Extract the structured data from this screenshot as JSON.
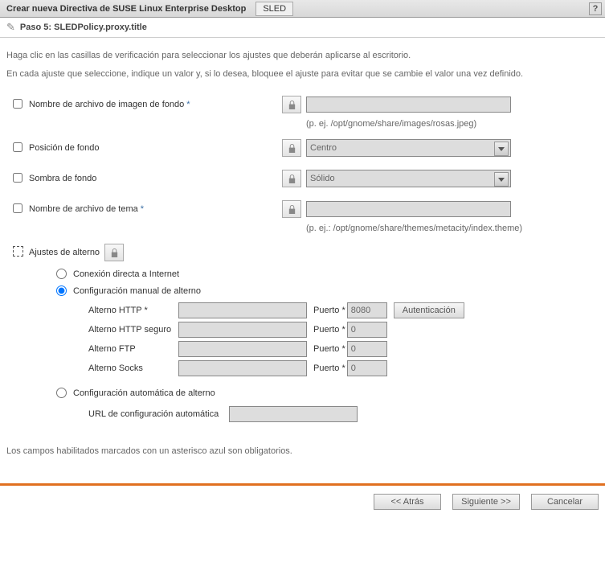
{
  "titlebar": {
    "title": "Crear nueva Directiva de SUSE Linux Enterprise Desktop",
    "tab": "SLED",
    "help": "?"
  },
  "step": {
    "prefix": "Paso 5:",
    "name": "SLEDPolicy.proxy.title"
  },
  "intro": {
    "line1": "Haga clic en las casillas de verificación para seleccionar los ajustes que deberán aplicarse al escritorio.",
    "line2": "En cada ajuste que seleccione, indique un valor y, si lo desea, bloquee el ajuste para evitar que se cambie el valor una vez definido."
  },
  "fields": {
    "bgimage": {
      "label": "Nombre de archivo de imagen de fondo",
      "required": true,
      "hint": "(p. ej. /opt/gnome/share/images/rosas.jpeg)",
      "value": ""
    },
    "bgpos": {
      "label": "Posición de fondo",
      "required": false,
      "value": "Centro"
    },
    "bgshade": {
      "label": "Sombra de fondo",
      "required": false,
      "value": "Sólido"
    },
    "theme": {
      "label": "Nombre de archivo de tema",
      "required": true,
      "hint": "(p. ej.: /opt/gnome/share/themes/metacity/index.theme)",
      "value": ""
    },
    "proxy": {
      "label": "Ajustes de alterno"
    }
  },
  "proxy": {
    "direct": "Conexión directa a Internet",
    "manual": "Configuración manual de alterno",
    "auto": "Configuración automática de alterno",
    "http": {
      "label": "Alterno HTTP",
      "required": true,
      "port_label": "Puerto",
      "port_required": true,
      "port_value": "8080"
    },
    "https": {
      "label": "Alterno HTTP seguro",
      "port_label": "Puerto",
      "port_required": true,
      "port_value": "0"
    },
    "ftp": {
      "label": "Alterno FTP",
      "port_label": "Puerto",
      "port_required": true,
      "port_value": "0"
    },
    "socks": {
      "label": "Alterno Socks",
      "port_label": "Puerto",
      "port_required": true,
      "port_value": "0"
    },
    "auth_btn": "Autenticación",
    "auto_url_label": "URL de configuración automática"
  },
  "footnote": "Los campos habilitados marcados con un asterisco azul son obligatorios.",
  "buttons": {
    "back": "<< Atrás",
    "next": "Siguiente >>",
    "cancel": "Cancelar"
  },
  "asterisk": "*"
}
